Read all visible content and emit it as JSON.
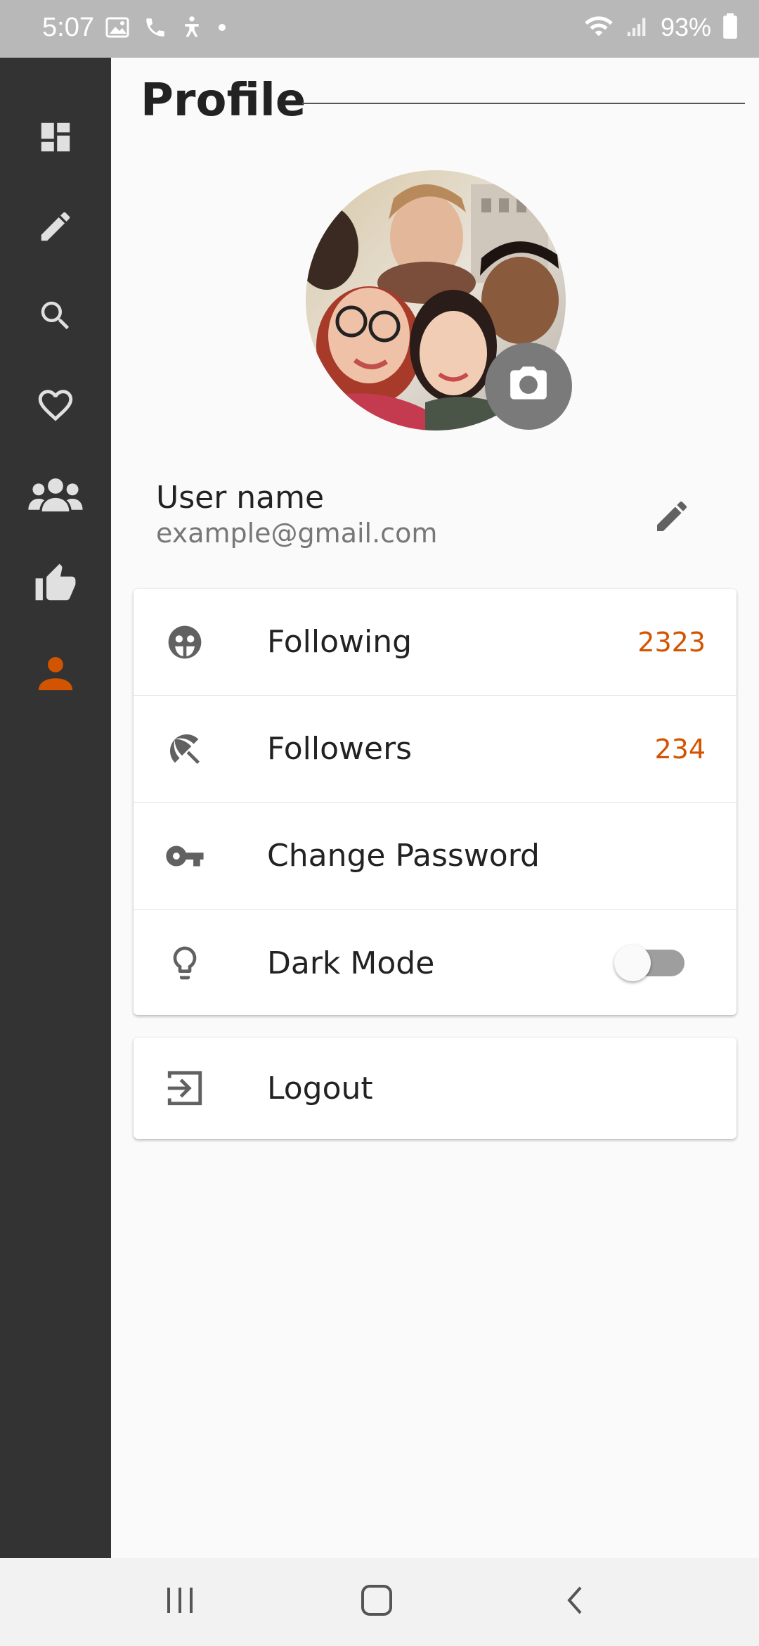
{
  "status_bar": {
    "time": "5:07",
    "battery": "93%",
    "left_icons": [
      "image-icon",
      "phone-icon",
      "accessibility-icon",
      "dot-icon"
    ],
    "right_icons": [
      "wifi-icon",
      "signal-icon",
      "battery-icon"
    ]
  },
  "sidebar": {
    "items": [
      {
        "name": "dashboard",
        "icon": "dashboard-icon",
        "active": false
      },
      {
        "name": "edit",
        "icon": "pencil-icon",
        "active": false
      },
      {
        "name": "search",
        "icon": "search-icon",
        "active": false
      },
      {
        "name": "favorites",
        "icon": "heart-icon",
        "active": false
      },
      {
        "name": "groups",
        "icon": "people-icon",
        "active": false
      },
      {
        "name": "likes",
        "icon": "thumb-up-icon",
        "active": false
      },
      {
        "name": "profile",
        "icon": "person-icon",
        "active": true
      }
    ],
    "background": "#333333",
    "active_color": "#d35400",
    "icon_color": "#e0e0e0"
  },
  "header": {
    "title": "Profile"
  },
  "user": {
    "name": "User name",
    "email": "example@gmail.com"
  },
  "menu": {
    "following": {
      "label": "Following",
      "count": "2323",
      "icon": "face-icon"
    },
    "followers": {
      "label": "Followers",
      "count": "234",
      "icon": "beach-umbrella-icon"
    },
    "change_password": {
      "label": "Change Password",
      "icon": "key-icon"
    },
    "dark_mode": {
      "label": "Dark Mode",
      "icon": "lightbulb-icon",
      "enabled": false
    },
    "logout": {
      "label": "Logout",
      "icon": "logout-icon"
    }
  },
  "colors": {
    "accent": "#d35400",
    "count": "#d35400"
  },
  "nav_bar": {
    "buttons": [
      "recents-icon",
      "home-icon",
      "back-icon"
    ]
  }
}
